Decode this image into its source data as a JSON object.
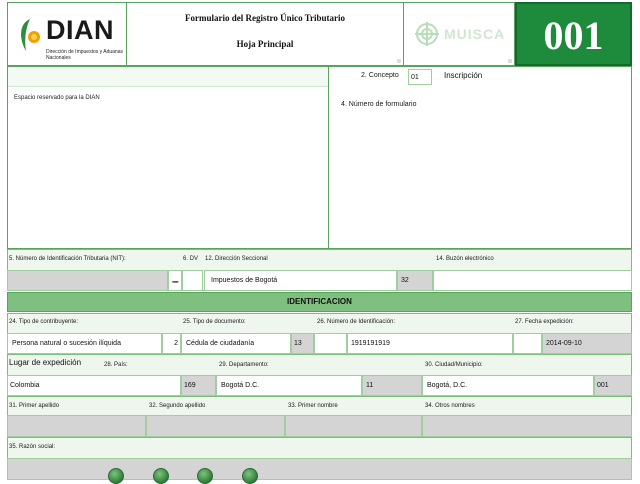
{
  "header": {
    "logo_text": "DIAN",
    "logo_subtitle": "Dirección de Impuestos y Aduanas Nacionales",
    "title_line1": "Formulario del Registro Único Tributario",
    "title_line2": "Hoja Principal",
    "muisca_text": "MUISCA",
    "form_number": "001"
  },
  "top": {
    "concepto_label": "2. Concepto",
    "concepto_value": "01",
    "concepto_desc": "Inscripción",
    "espacio_label": "Espacio reservado para la DIAN",
    "numero_formulario_label": "4. Número de formulario"
  },
  "nit_row": {
    "nit_label": "5. Número de Identificación Tributaria (NIT):",
    "dv_label": "6. DV",
    "dv_dash": "–",
    "seccional_label": "12. Dirección Seccional",
    "seccional_value": "Impuestos de Bogotá",
    "seccional_code": "32",
    "buzon_label": "14. Buzón electrónico"
  },
  "section": {
    "identificacion": "IDENTIFICACION"
  },
  "ident": {
    "tipo_contrib_label": "24. Tipo de contribuyente:",
    "tipo_contrib_value": "Persona natural o sucesión ilíquida",
    "tipo_contrib_code": "2",
    "tipo_doc_label": "25. Tipo de documento:",
    "tipo_doc_value": "Cédula de ciudadanía",
    "tipo_doc_code": "13",
    "num_ident_label": "26. Número de Identificación:",
    "num_ident_value": "1919191919",
    "fecha_exp_label": "27. Fecha expedición:",
    "fecha_exp_value": "2014-09-10"
  },
  "lugar": {
    "lugar_label": "Lugar de expedición",
    "pais_label": "28. País:",
    "pais_value": "Colombia",
    "pais_code": "169",
    "depto_label": "29. Departamento:",
    "depto_value": "Bogotá D.C.",
    "depto_code": "11",
    "ciudad_label": "30. Ciudad/Municipio:",
    "ciudad_value": "Bogotá, D.C.",
    "ciudad_code": "001"
  },
  "names": {
    "primer_apellido_label": "31. Primer apellido",
    "segundo_apellido_label": "32. Segundo apellido",
    "primer_nombre_label": "33. Primer nombre",
    "otros_nombres_label": "34. Otros nombres"
  },
  "razon": {
    "razon_social_label": "35. Razón social:"
  },
  "colors": {
    "brand_green": "#1e8a3c",
    "section_green": "#7fbf7f",
    "border_green": "#5aa35a"
  }
}
